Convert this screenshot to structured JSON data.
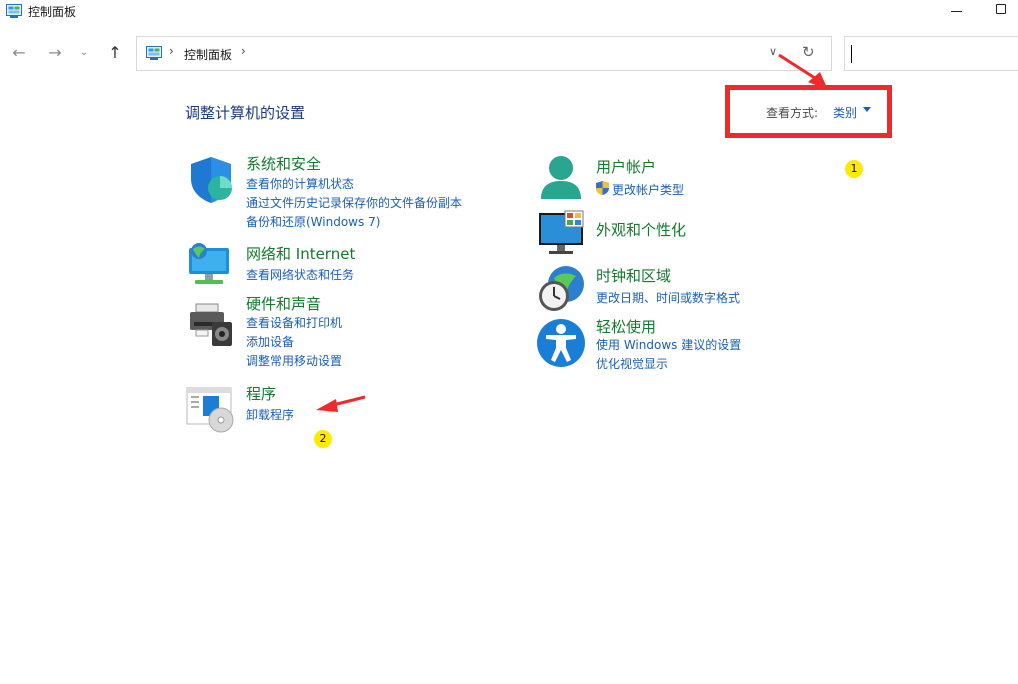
{
  "window": {
    "title": "控制面板",
    "app_icon": "control-panel-icon",
    "controls": [
      "minimize-icon",
      "maximize-icon"
    ]
  },
  "navigation": {
    "back_icon": "back-arrow-icon",
    "forward_icon": "forward-arrow-icon",
    "recent_icon": "chevron-down-icon",
    "up_icon": "up-arrow-icon"
  },
  "address_bar": {
    "path": "控制面板",
    "separator": "›",
    "dropdown_icon": "chevron-down-icon",
    "refresh_icon": "refresh-icon"
  },
  "search": {
    "value": ""
  },
  "main": {
    "title": "调整计算机的设置",
    "view_by": {
      "label": "查看方式:",
      "value": "类别"
    }
  },
  "categories": {
    "system_security": {
      "icon": "shield-icon",
      "title": "系统和安全",
      "links": [
        "查看你的计算机状态",
        "通过文件历史记录保存你的文件备份副本",
        "备份和还原(Windows 7)"
      ]
    },
    "network": {
      "icon": "network-globe-icon",
      "title": "网络和 Internet",
      "links": [
        "查看网络状态和任务"
      ]
    },
    "hardware": {
      "icon": "printer-speaker-icon",
      "title": "硬件和声音",
      "links": [
        "查看设备和打印机",
        "添加设备",
        "调整常用移动设置"
      ]
    },
    "programs": {
      "icon": "programs-disc-icon",
      "title": "程序",
      "links": [
        "卸载程序"
      ]
    },
    "user_accounts": {
      "icon": "user-account-icon",
      "title": "用户帐户",
      "links": [
        "更改帐户类型"
      ]
    },
    "appearance": {
      "icon": "monitor-palette-icon",
      "title": "外观和个性化",
      "links": []
    },
    "clock_region": {
      "icon": "clock-globe-icon",
      "title": "时钟和区域",
      "links": [
        "更改日期、时间或数字格式"
      ]
    },
    "ease_of_access": {
      "icon": "accessibility-icon",
      "title": "轻松使用",
      "links": [
        "使用 Windows 建议的设置",
        "优化视觉显示"
      ]
    }
  },
  "annotations": {
    "markers": [
      "1",
      "2"
    ],
    "highlight_color": "#ee2a2a",
    "marker_color": "#ffea00"
  },
  "colors": {
    "category_title": "#137a2e",
    "link": "#1a5fb4",
    "page_title": "#1e3a78"
  }
}
